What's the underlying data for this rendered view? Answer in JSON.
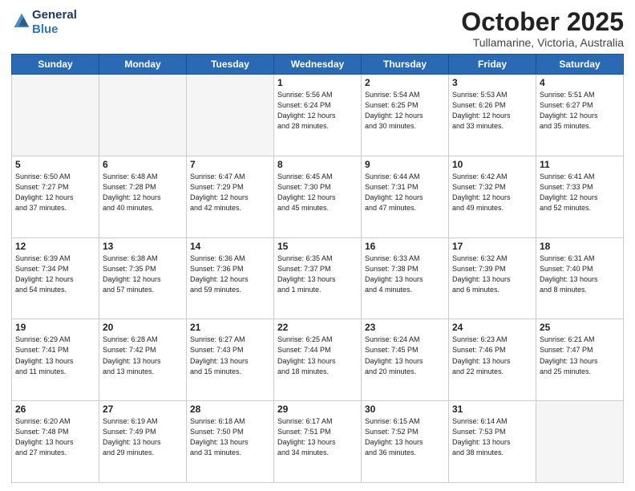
{
  "header": {
    "logo_line1": "General",
    "logo_line2": "Blue",
    "month": "October 2025",
    "location": "Tullamarine, Victoria, Australia"
  },
  "weekdays": [
    "Sunday",
    "Monday",
    "Tuesday",
    "Wednesday",
    "Thursday",
    "Friday",
    "Saturday"
  ],
  "weeks": [
    [
      {
        "day": "",
        "info": ""
      },
      {
        "day": "",
        "info": ""
      },
      {
        "day": "",
        "info": ""
      },
      {
        "day": "1",
        "info": "Sunrise: 5:56 AM\nSunset: 6:24 PM\nDaylight: 12 hours\nand 28 minutes."
      },
      {
        "day": "2",
        "info": "Sunrise: 5:54 AM\nSunset: 6:25 PM\nDaylight: 12 hours\nand 30 minutes."
      },
      {
        "day": "3",
        "info": "Sunrise: 5:53 AM\nSunset: 6:26 PM\nDaylight: 12 hours\nand 33 minutes."
      },
      {
        "day": "4",
        "info": "Sunrise: 5:51 AM\nSunset: 6:27 PM\nDaylight: 12 hours\nand 35 minutes."
      }
    ],
    [
      {
        "day": "5",
        "info": "Sunrise: 6:50 AM\nSunset: 7:27 PM\nDaylight: 12 hours\nand 37 minutes."
      },
      {
        "day": "6",
        "info": "Sunrise: 6:48 AM\nSunset: 7:28 PM\nDaylight: 12 hours\nand 40 minutes."
      },
      {
        "day": "7",
        "info": "Sunrise: 6:47 AM\nSunset: 7:29 PM\nDaylight: 12 hours\nand 42 minutes."
      },
      {
        "day": "8",
        "info": "Sunrise: 6:45 AM\nSunset: 7:30 PM\nDaylight: 12 hours\nand 45 minutes."
      },
      {
        "day": "9",
        "info": "Sunrise: 6:44 AM\nSunset: 7:31 PM\nDaylight: 12 hours\nand 47 minutes."
      },
      {
        "day": "10",
        "info": "Sunrise: 6:42 AM\nSunset: 7:32 PM\nDaylight: 12 hours\nand 49 minutes."
      },
      {
        "day": "11",
        "info": "Sunrise: 6:41 AM\nSunset: 7:33 PM\nDaylight: 12 hours\nand 52 minutes."
      }
    ],
    [
      {
        "day": "12",
        "info": "Sunrise: 6:39 AM\nSunset: 7:34 PM\nDaylight: 12 hours\nand 54 minutes."
      },
      {
        "day": "13",
        "info": "Sunrise: 6:38 AM\nSunset: 7:35 PM\nDaylight: 12 hours\nand 57 minutes."
      },
      {
        "day": "14",
        "info": "Sunrise: 6:36 AM\nSunset: 7:36 PM\nDaylight: 12 hours\nand 59 minutes."
      },
      {
        "day": "15",
        "info": "Sunrise: 6:35 AM\nSunset: 7:37 PM\nDaylight: 13 hours\nand 1 minute."
      },
      {
        "day": "16",
        "info": "Sunrise: 6:33 AM\nSunset: 7:38 PM\nDaylight: 13 hours\nand 4 minutes."
      },
      {
        "day": "17",
        "info": "Sunrise: 6:32 AM\nSunset: 7:39 PM\nDaylight: 13 hours\nand 6 minutes."
      },
      {
        "day": "18",
        "info": "Sunrise: 6:31 AM\nSunset: 7:40 PM\nDaylight: 13 hours\nand 8 minutes."
      }
    ],
    [
      {
        "day": "19",
        "info": "Sunrise: 6:29 AM\nSunset: 7:41 PM\nDaylight: 13 hours\nand 11 minutes."
      },
      {
        "day": "20",
        "info": "Sunrise: 6:28 AM\nSunset: 7:42 PM\nDaylight: 13 hours\nand 13 minutes."
      },
      {
        "day": "21",
        "info": "Sunrise: 6:27 AM\nSunset: 7:43 PM\nDaylight: 13 hours\nand 15 minutes."
      },
      {
        "day": "22",
        "info": "Sunrise: 6:25 AM\nSunset: 7:44 PM\nDaylight: 13 hours\nand 18 minutes."
      },
      {
        "day": "23",
        "info": "Sunrise: 6:24 AM\nSunset: 7:45 PM\nDaylight: 13 hours\nand 20 minutes."
      },
      {
        "day": "24",
        "info": "Sunrise: 6:23 AM\nSunset: 7:46 PM\nDaylight: 13 hours\nand 22 minutes."
      },
      {
        "day": "25",
        "info": "Sunrise: 6:21 AM\nSunset: 7:47 PM\nDaylight: 13 hours\nand 25 minutes."
      }
    ],
    [
      {
        "day": "26",
        "info": "Sunrise: 6:20 AM\nSunset: 7:48 PM\nDaylight: 13 hours\nand 27 minutes."
      },
      {
        "day": "27",
        "info": "Sunrise: 6:19 AM\nSunset: 7:49 PM\nDaylight: 13 hours\nand 29 minutes."
      },
      {
        "day": "28",
        "info": "Sunrise: 6:18 AM\nSunset: 7:50 PM\nDaylight: 13 hours\nand 31 minutes."
      },
      {
        "day": "29",
        "info": "Sunrise: 6:17 AM\nSunset: 7:51 PM\nDaylight: 13 hours\nand 34 minutes."
      },
      {
        "day": "30",
        "info": "Sunrise: 6:15 AM\nSunset: 7:52 PM\nDaylight: 13 hours\nand 36 minutes."
      },
      {
        "day": "31",
        "info": "Sunrise: 6:14 AM\nSunset: 7:53 PM\nDaylight: 13 hours\nand 38 minutes."
      },
      {
        "day": "",
        "info": ""
      }
    ]
  ]
}
